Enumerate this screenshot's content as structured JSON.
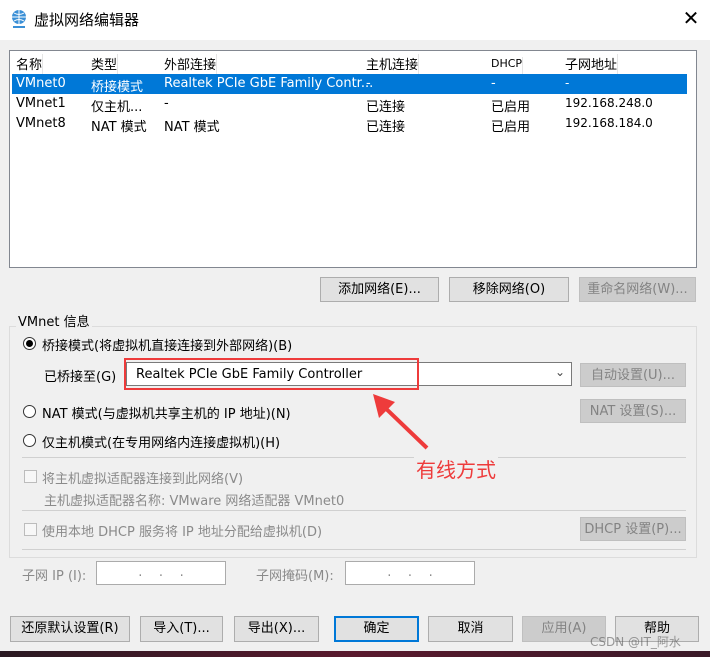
{
  "window": {
    "title": "虚拟网络编辑器",
    "close": "✕"
  },
  "table": {
    "headers": [
      "名称",
      "类型",
      "外部连接",
      "主机连接",
      "DHCP",
      "子网地址"
    ],
    "rows": [
      [
        "VMnet0",
        "桥接模式",
        "Realtek PCIe GbE Family Contr...",
        "-",
        "-",
        "-"
      ],
      [
        "VMnet1",
        "仅主机...",
        "-",
        "已连接",
        "已启用",
        "192.168.248.0"
      ],
      [
        "VMnet8",
        "NAT 模式",
        "NAT 模式",
        "已连接",
        "已启用",
        "192.168.184.0"
      ]
    ],
    "selected_index": 0
  },
  "list_buttons": {
    "add": "添加网络(E)...",
    "remove": "移除网络(O)",
    "rename": "重命名网络(W)..."
  },
  "vmnet_info": {
    "label": "VMnet 信息",
    "bridged": "桥接模式(将虚拟机直接连接到外部网络)(B)",
    "bridged_to_label": "已桥接至(G)",
    "bridged_to_value": "Realtek PCIe GbE Family Controller",
    "auto_settings": "自动设置(U)...",
    "nat": "NAT 模式(与虚拟机共享主机的 IP 地址)(N)",
    "nat_settings": "NAT 设置(S)...",
    "host_only": "仅主机模式(在专用网络内连接虚拟机)(H)",
    "connect_adapter": "将主机虚拟适配器连接到此网络(V)",
    "adapter_name": "主机虚拟适配器名称: VMware 网络适配器 VMnet0",
    "use_dhcp": "使用本地 DHCP 服务将 IP 地址分配给虚拟机(D)",
    "dhcp_settings": "DHCP 设置(P)...",
    "subnet_ip_label": "子网 IP (I):",
    "subnet_ip_value": ".    .    .",
    "subnet_mask_label": "子网掩码(M):",
    "subnet_mask_value": ".    .    ."
  },
  "annotation": {
    "text": "有线方式",
    "color": "#ee3b3b"
  },
  "footer": {
    "restore": "还原默认设置(R)",
    "import": "导入(T)...",
    "export": "导出(X)...",
    "ok": "确定",
    "cancel": "取消",
    "apply": "应用(A)",
    "help": "帮助"
  },
  "watermark": "CSDN @IT_阿水"
}
